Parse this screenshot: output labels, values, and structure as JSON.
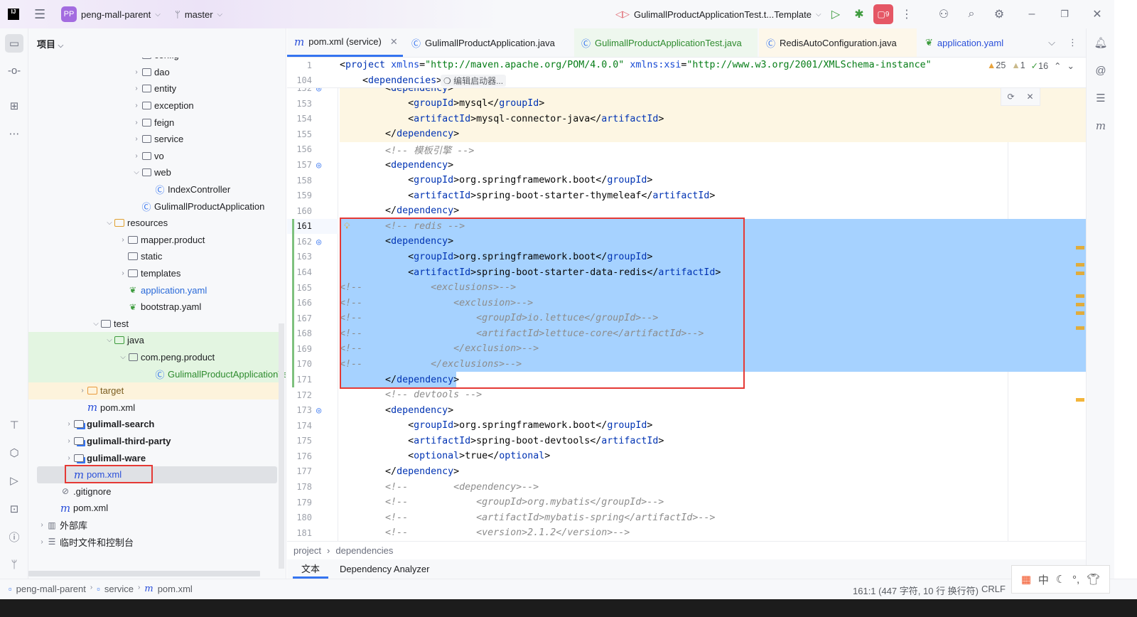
{
  "titlebar": {
    "project_badge": "PP",
    "project": "peng-mall-parent",
    "branch": "master",
    "run_config": "GulimallProductApplicationTest.t...Template",
    "notif_count": "9"
  },
  "project_panel": {
    "title": "项目"
  },
  "tree": [
    {
      "level": 7,
      "chev": ">",
      "icon": "package",
      "label": "config"
    },
    {
      "level": 7,
      "chev": ">",
      "icon": "package",
      "label": "dao"
    },
    {
      "level": 7,
      "chev": ">",
      "icon": "package",
      "label": "entity"
    },
    {
      "level": 7,
      "chev": ">",
      "icon": "package",
      "label": "exception"
    },
    {
      "level": 7,
      "chev": ">",
      "icon": "package",
      "label": "feign"
    },
    {
      "level": 7,
      "chev": ">",
      "icon": "package",
      "label": "service"
    },
    {
      "level": 7,
      "chev": ">",
      "icon": "package",
      "label": "vo"
    },
    {
      "level": 7,
      "chev": "v",
      "icon": "package",
      "label": "web"
    },
    {
      "level": 8,
      "chev": "",
      "icon": "class",
      "label": "IndexController"
    },
    {
      "level": 7,
      "chev": "",
      "icon": "spring-class",
      "label": "GulimallProductApplication"
    },
    {
      "level": 5,
      "chev": "v",
      "icon": "resources-folder",
      "label": "resources"
    },
    {
      "level": 6,
      "chev": ">",
      "icon": "folder",
      "label": "mapper.product"
    },
    {
      "level": 6,
      "chev": "",
      "icon": "folder",
      "label": "static"
    },
    {
      "level": 6,
      "chev": ">",
      "icon": "folder",
      "label": "templates"
    },
    {
      "level": 6,
      "chev": "",
      "icon": "yaml",
      "label": "application.yaml",
      "color": "#2a6ad9"
    },
    {
      "level": 6,
      "chev": "",
      "icon": "yaml",
      "label": "bootstrap.yaml"
    },
    {
      "level": 4,
      "chev": "v",
      "icon": "folder",
      "label": "test"
    },
    {
      "level": 5,
      "chev": "v",
      "icon": "test-folder",
      "label": "java",
      "bg": "#e3f5e1"
    },
    {
      "level": 6,
      "chev": "v",
      "icon": "package",
      "label": "com.peng.product",
      "bg": "#e3f5e1"
    },
    {
      "level": 8,
      "chev": "",
      "icon": "test-class",
      "label": "GulimallProductApplicationTest",
      "color": "#2e8b2e",
      "bg": "#e3f5e1"
    },
    {
      "level": 3,
      "chev": ">",
      "icon": "excluded-folder",
      "label": "target",
      "color": "#7a5c1f",
      "bg": "#fdf3dc"
    },
    {
      "level": 3,
      "chev": "",
      "icon": "maven",
      "label": "pom.xml"
    },
    {
      "level": 2,
      "chev": ">",
      "icon": "module",
      "label": "gulimall-search",
      "bold": true
    },
    {
      "level": 2,
      "chev": ">",
      "icon": "module",
      "label": "gulimall-third-party",
      "bold": true
    },
    {
      "level": 2,
      "chev": ">",
      "icon": "module",
      "label": "gulimall-ware",
      "bold": true
    },
    {
      "level": 2,
      "chev": "",
      "icon": "maven",
      "label": "pom.xml",
      "color": "#2a4fd9",
      "selected": true,
      "boxed": true
    },
    {
      "level": 1,
      "chev": "",
      "icon": "ignored",
      "label": ".gitignore"
    },
    {
      "level": 1,
      "chev": "",
      "icon": "maven",
      "label": "pom.xml"
    },
    {
      "level": 0,
      "chev": ">",
      "icon": "library",
      "label": "外部库"
    },
    {
      "level": 0,
      "chev": ">",
      "icon": "scratches",
      "label": "临时文件和控制台"
    }
  ],
  "tabs": [
    {
      "label": "pom.xml (service)",
      "icon": "maven",
      "active": true,
      "closable": true
    },
    {
      "label": "GulimallProductApplication.java",
      "icon": "spring-class"
    },
    {
      "label": "GulimallProductApplicationTest.java",
      "icon": "test-class",
      "color": "#2e8b2e",
      "bg": "#eef7ee"
    },
    {
      "label": "RedisAutoConfiguration.java",
      "icon": "class",
      "bg": "#fdf7ea"
    },
    {
      "label": "application.yaml",
      "icon": "yaml",
      "color": "#2a4fd9"
    }
  ],
  "inspections": {
    "warnings": "25",
    "weak_warnings": "1",
    "typos": "16"
  },
  "sticky": [
    {
      "num": "1",
      "code": "<project xmlns=\"http://maven.apache.org/POM/4.0.0\" xmlns:xsi=\"http://www.w3.org/2001/XMLSchema-instance\""
    },
    {
      "num": "104",
      "code": "    <dependencies>",
      "hint": "编辑启动器..."
    }
  ],
  "code": {
    "first_line": 152,
    "current_line": 161,
    "selection": {
      "from": 161,
      "to": 171
    },
    "lines": [
      "        <dependency>",
      "            <groupId>mysql</groupId>",
      "            <artifactId>mysql-connector-java</artifactId>",
      "        </dependency>",
      "        <!-- 模板引擎 -->",
      "        <dependency>",
      "            <groupId>org.springframework.boot</groupId>",
      "            <artifactId>spring-boot-starter-thymeleaf</artifactId>",
      "        </dependency>",
      "        <!-- redis -->",
      "        <dependency>",
      "            <groupId>org.springframework.boot</groupId>",
      "            <artifactId>spring-boot-starter-data-redis</artifactId>",
      "<!--            <exclusions>-->",
      "<!--                <exclusion>-->",
      "<!--                    <groupId>io.lettuce</groupId>-->",
      "<!--                    <artifactId>lettuce-core</artifactId>-->",
      "<!--                </exclusion>-->",
      "<!--            </exclusions>-->",
      "        </dependency>",
      "        <!-- devtools -->",
      "        <dependency>",
      "            <groupId>org.springframework.boot</groupId>",
      "            <artifactId>spring-boot-devtools</artifactId>",
      "            <optional>true</optional>",
      "        </dependency>",
      "        <!--        <dependency>-->",
      "        <!--            <groupId>org.mybatis</groupId>-->",
      "        <!--            <artifactId>mybatis-spring</artifactId>-->",
      "        <!--            <version>2.1.2</version>-->"
    ],
    "dependency_gutter_lines": [
      152,
      157,
      162,
      173
    ],
    "highlighted_lines": [
      152,
      153,
      154,
      155
    ]
  },
  "breadcrumb": [
    "project",
    "dependencies"
  ],
  "bottom_tabs": [
    "文本",
    "Dependency Analyzer"
  ],
  "status": {
    "path": [
      "peng-mall-parent",
      "service",
      "pom.xml"
    ],
    "position": "161:1 (447 字符, 10 行 换行符)",
    "line_sep": "CRLF"
  },
  "ime": {
    "lang": "中"
  },
  "colors": {
    "accent": "#3574f0",
    "selection": "#a6d2ff",
    "annotation_box": "#e53935"
  }
}
